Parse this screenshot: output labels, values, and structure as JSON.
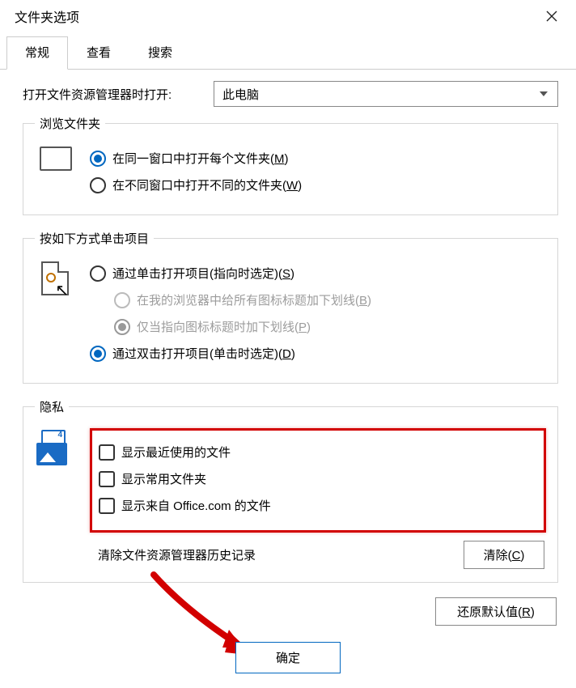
{
  "window": {
    "title": "文件夹选项"
  },
  "tabs": {
    "general": "常规",
    "view": "查看",
    "search": "搜索"
  },
  "open_explorer": {
    "label": "打开文件资源管理器时打开:",
    "value": "此电脑"
  },
  "browse": {
    "legend": "浏览文件夹",
    "same_window": "在同一窗口中打开每个文件夹(",
    "same_window_k": "M",
    "diff_window": "在不同窗口中打开不同的文件夹(",
    "diff_window_k": "W"
  },
  "click": {
    "legend": "按如下方式单击项目",
    "single": "通过单击打开项目(指向时选定)(",
    "single_k": "S",
    "sub1": "在我的浏览器中给所有图标标题加下划线(",
    "sub1_k": "B",
    "sub2": "仅当指向图标标题时加下划线(",
    "sub2_k": "P",
    "double": "通过双击打开项目(单击时选定)(",
    "double_k": "D"
  },
  "privacy": {
    "legend": "隐私",
    "recent": "显示最近使用的文件",
    "frequent": "显示常用文件夹",
    "office": "显示来自 Office.com 的文件",
    "clear_label": "清除文件资源管理器历史记录",
    "clear_btn": "清除(",
    "clear_k": "C"
  },
  "restore": {
    "label": "还原默认值(",
    "key": "R"
  },
  "ok_btn": "确定",
  "paren_close": ")"
}
